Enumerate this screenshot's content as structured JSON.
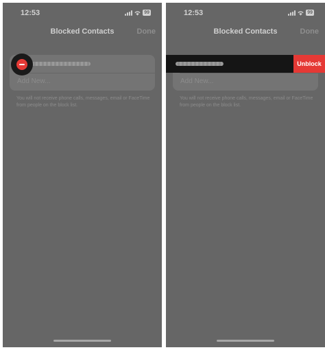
{
  "left_screen": {
    "status_time": "12:53",
    "battery_level": "99",
    "nav_title": "Blocked Contacts",
    "done_label": "Done",
    "add_new_label": "Add New...",
    "footer_note": "You will not receive phone calls, messages, email or FaceTime from people on the block list.",
    "minus_icon": "minus-circle-icon"
  },
  "right_screen": {
    "status_time": "12:53",
    "battery_level": "99",
    "nav_title": "Blocked Contacts",
    "done_label": "Done",
    "add_new_label": "Add New...",
    "footer_note": "You will not receive phone calls, messages, email or FaceTime from people on the block list.",
    "unblock_label": "Unblock"
  },
  "colors": {
    "screen_background": "#666666",
    "destructive_red": "#e53935",
    "swipe_row_background": "#151515"
  }
}
